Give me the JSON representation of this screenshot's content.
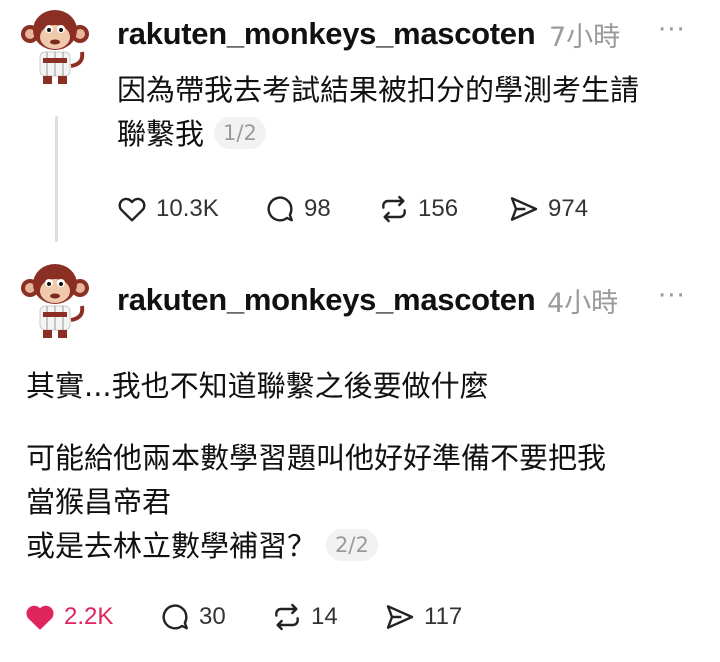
{
  "posts": [
    {
      "username": "rakuten_monkeys_mascoten",
      "time": "7小時",
      "more": "···",
      "lines": [
        "因為帶我去考試結果被扣分的學測考生請",
        "聯繫我"
      ],
      "counter": "1/2",
      "actions": {
        "likes": "10.3K",
        "replies": "98",
        "reposts": "156",
        "shares": "974"
      },
      "liked": false
    },
    {
      "username": "rakuten_monkeys_mascoten",
      "time": "4小時",
      "more": "···",
      "lines": [
        "其實...我也不知道聯繫之後要做什麼",
        "可能給他兩本數學習題叫他好好準備不要把我",
        "當猴昌帝君",
        "或是去林立數學補習？"
      ],
      "counter": "2/2",
      "actions": {
        "likes": "2.2K",
        "replies": "30",
        "reposts": "14",
        "shares": "117"
      },
      "liked": true
    }
  ],
  "colors": {
    "like_active": "#e0245e",
    "muted": "#9a9a9a",
    "avatar_fur": "#8b2f25"
  },
  "icons": [
    "monkey-mascot-avatar",
    "heart-icon",
    "comment-icon",
    "repost-icon",
    "share-icon",
    "more-icon"
  ]
}
